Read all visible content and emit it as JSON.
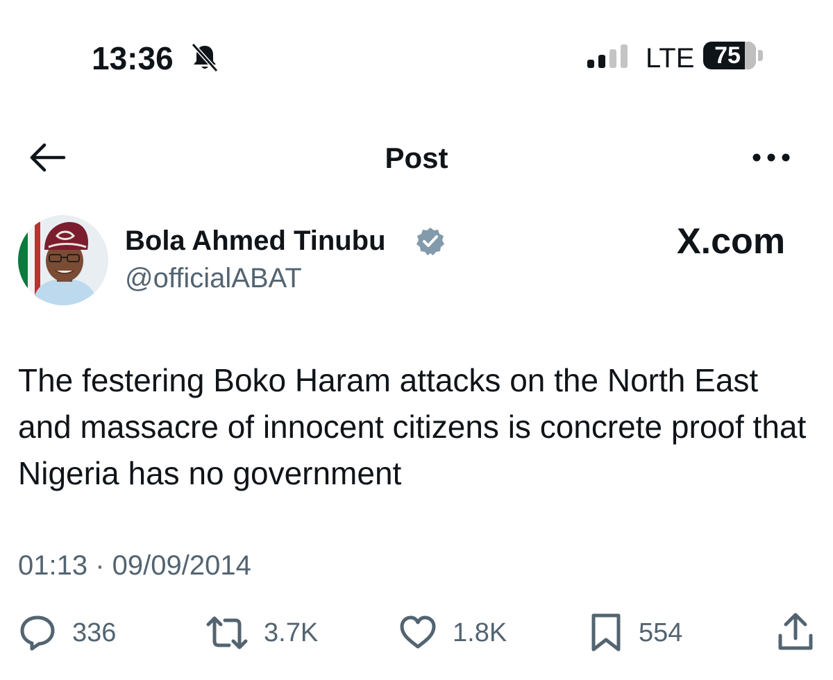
{
  "status_bar": {
    "time": "13:36",
    "network": "LTE",
    "battery_level": "75",
    "bell_icon": "bell-slash-icon",
    "signal_icon": "cellular-signal-icon"
  },
  "nav": {
    "title": "Post",
    "back_icon": "arrow-left-icon",
    "more_icon": "ellipsis-icon"
  },
  "post": {
    "author_name": "Bola Ahmed Tinubu",
    "author_handle": "@officialABAT",
    "verified_icon": "verified-badge-icon",
    "source_label": "X.com",
    "text": "The festering Boko Haram attacks on the North East and massacre of innocent citizens is concrete proof that Nigeria has no government",
    "timestamp": "01:13 · 09/09/2014"
  },
  "actions": {
    "replies": "336",
    "reposts": "3.7K",
    "likes": "1.8K",
    "bookmarks": "554"
  },
  "colors": {
    "text_primary": "#0f1419",
    "text_secondary": "#536471",
    "verified_badge": "#829aab"
  }
}
